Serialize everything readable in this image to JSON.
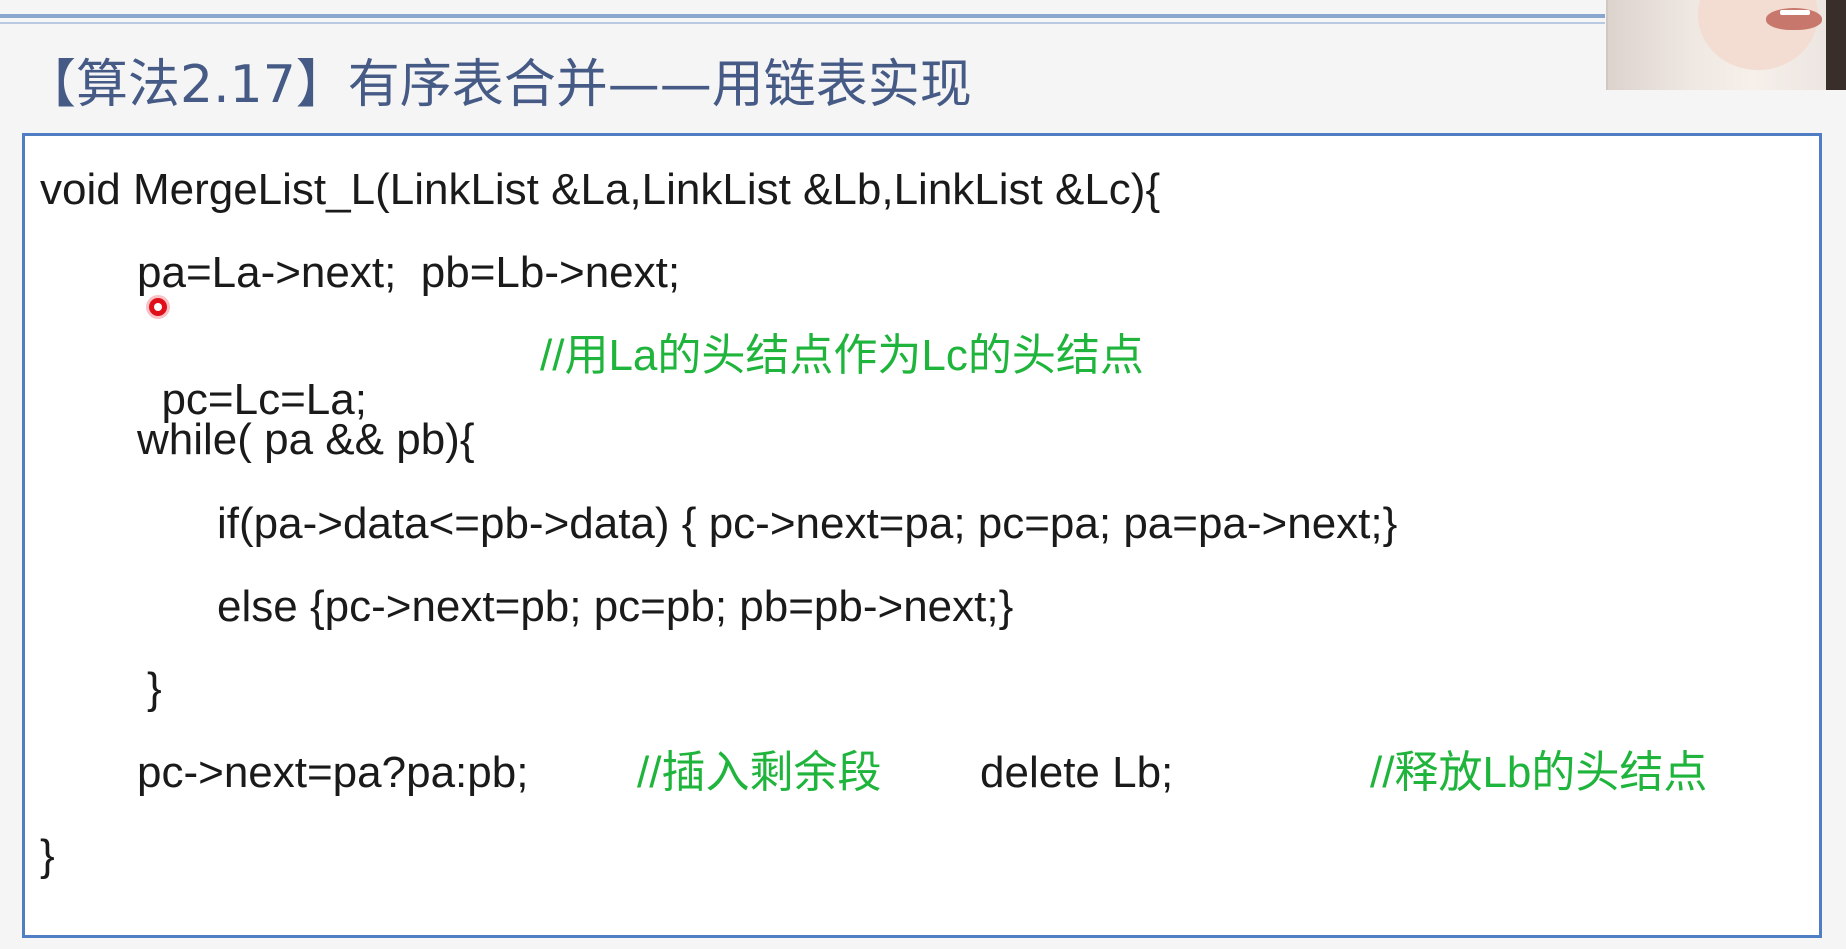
{
  "slide": {
    "title": "【算法2.17】有序表合并——用链表实现"
  },
  "code": {
    "line1": "void MergeList_L(LinkList &La,LinkList &Lb,LinkList &Lc){",
    "line2": "pa=La->next;  pb=Lb->next;",
    "line3_code": "pc=Lc=La;",
    "line3_comment": "//用La的头结点作为Lc的头结点",
    "line4": "while( pa && pb){",
    "line5": "if(pa->data<=pb->data) { pc->next=pa; pc=pa; pa=pa->next;}",
    "line6": "else {pc->next=pb; pc=pb; pb=pb->next;}",
    "line7": "}",
    "line8_code": "pc->next=pa?pa:pb;",
    "line8_comment1": "//插入剩余段",
    "line8_code2": "delete Lb;",
    "line8_comment2": "//释放Lb的头结点",
    "line9": "}"
  },
  "colors": {
    "title": "#465a86",
    "border": "#4f7ec4",
    "comment": "#1fb43b",
    "pointer": "#e0101a"
  },
  "icons": {
    "pointer": "laser-pointer-icon"
  }
}
